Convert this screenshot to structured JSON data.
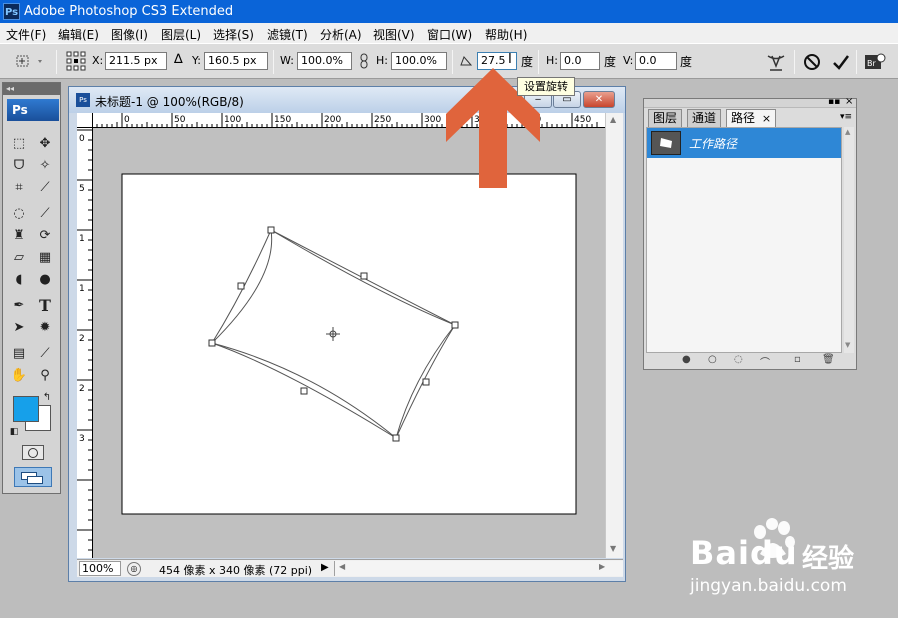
{
  "app": {
    "title": "Adobe Photoshop CS3 Extended",
    "badge": "Ps"
  },
  "menu": [
    "文件(F)",
    "编辑(E)",
    "图像(I)",
    "图层(L)",
    "选择(S)",
    "滤镜(T)",
    "分析(A)",
    "视图(V)",
    "窗口(W)",
    "帮助(H)"
  ],
  "options": {
    "x_label": "X:",
    "x_value": "211.5 px",
    "y_label": "Y:",
    "y_value": "160.5 px",
    "w_label": "W:",
    "w_value": "100.0%",
    "h_label": "H:",
    "h_value": "100.0%",
    "angle_value": "27.5",
    "deg": "度",
    "hskew_label": "H:",
    "hskew_value": "0.0",
    "vskew_label": "V:",
    "vskew_value": "0.0",
    "tooltip": "设置旋转"
  },
  "toolbox": {
    "logo": "Ps",
    "collapse": "◂◂"
  },
  "document": {
    "title": "未标题-1 @ 100%(RGB/8)",
    "icon": "Ps",
    "zoom": "100%",
    "info": "454 像素 x 340 像素 (72 ppi)",
    "ruler_h": [
      "0",
      "50",
      "100",
      "150",
      "200",
      "250",
      "300",
      "350",
      "400",
      "450"
    ],
    "ruler_v": [
      "0",
      "5",
      "1",
      "1",
      "2",
      "2",
      "3"
    ]
  },
  "panel": {
    "tabs": [
      "图层",
      "通道",
      "路径"
    ],
    "tab_close": "×",
    "path_name": "工作路径"
  },
  "colors": {
    "accent": "#0a64d8",
    "arrow": "#e0643c",
    "foreground": "#16a0ea",
    "selection": "#2e87d6"
  },
  "watermark": {
    "brand": "Baidu",
    "cn": "经验",
    "url": "jingyan.baidu.com"
  }
}
